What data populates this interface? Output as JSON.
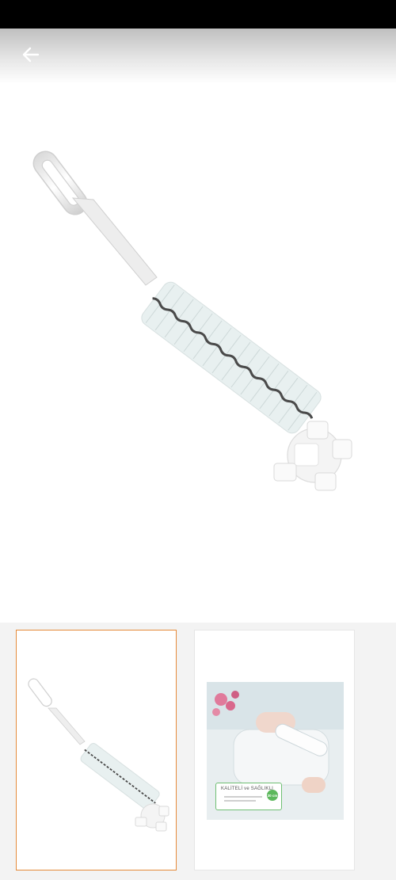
{
  "header": {
    "back_icon": "arrow-left-icon"
  },
  "product": {
    "main_image": "white bottle cleaning brush with sponge tip",
    "colors": {
      "selected_border": "#e58a3a",
      "status_bar": "#000000",
      "badge_green": "#5cb85c"
    }
  },
  "thumbnails": [
    {
      "selected": true
    },
    {
      "selected": false,
      "promo_title": "KALİTELİ ve SAĞLIKLI",
      "badge_text": "30 cm"
    }
  ]
}
